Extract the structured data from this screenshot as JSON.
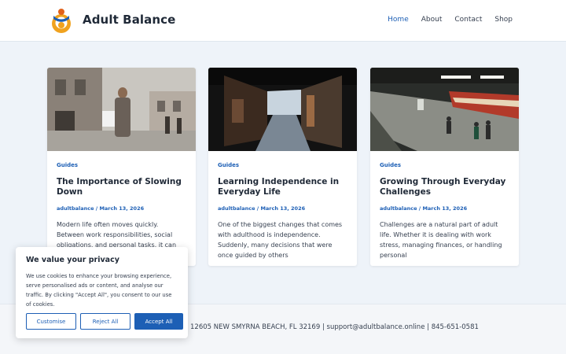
{
  "header": {
    "site_title": "Adult Balance",
    "nav": [
      "Home",
      "About",
      "Contact",
      "Shop"
    ]
  },
  "posts": [
    {
      "category": "Guides",
      "title_line1": "The Importance of Slowing",
      "title_line2": "Down",
      "meta": "adultbalance / March 13, 2026",
      "excerpt_lines": [
        "Modern life often moves quickly.",
        "Between work responsibilities, social",
        "obligations, and personal tasks, it can"
      ]
    },
    {
      "category": "Guides",
      "title_line1": "Learning Independence in",
      "title_line2": "Everyday Life",
      "meta": "adultbalance / March 13, 2026",
      "excerpt_lines": [
        "One of the biggest changes that comes",
        "with adulthood is independence.",
        "Suddenly, many decisions that were",
        "once guided by others"
      ]
    },
    {
      "category": "Guides",
      "title_line1": "Growing Through Everyday",
      "title_line2": "Challenges",
      "meta": "adultbalance / March 13, 2026",
      "excerpt_lines": [
        "Challenges are a natural part of adult",
        "life. Whether it is dealing with work",
        "stress, managing finances, or handling",
        "personal"
      ]
    }
  ],
  "footer": {
    "text": "12605 NEW SMYRNA BEACH, FL 32169 | support@adultbalance.online | 845-651-0581"
  },
  "cookie": {
    "title": "We value your privacy",
    "text_lines": [
      "We use cookies to enhance your browsing experience,",
      "serve personalised ads or content, and analyse our",
      "traffic. By clicking \"Accept All\", you consent to our use",
      "of cookies."
    ],
    "customise": "Customise",
    "reject": "Reject All",
    "accept": "Accept All"
  },
  "colors": {
    "accent": "#1d5fb5",
    "background": "#eef3f9"
  }
}
